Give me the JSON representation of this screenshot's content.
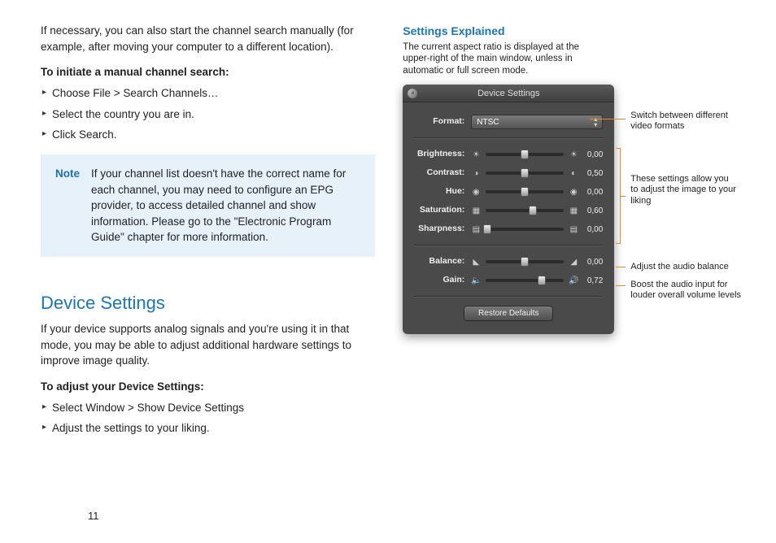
{
  "page_number": "11",
  "left": {
    "intro": "If necessary, you can also start the channel search manually (for example, after moving your computer to a different location).",
    "manual_search_heading": "To initiate a manual channel search:",
    "manual_search_steps": [
      "Choose File > Search Channels…",
      "Select the country you are in.",
      "Click Search."
    ],
    "note_label": "Note",
    "note_body": "If your channel list doesn't have the correct name for each channel, you may need to configure an EPG provider, to access detailed channel and show information. Please go to the \"Electronic Program Guide\" chapter for more information.",
    "h2": "Device Settings",
    "ds_intro": "If your device supports analog signals and you're using it in that mode, you may be able to adjust additional hardware settings to improve image quality.",
    "ds_heading": "To adjust your Device Settings:",
    "ds_steps": [
      "Select Window > Show Device Settings",
      "Adjust the settings to your liking."
    ]
  },
  "right": {
    "se_title": "Settings Explained",
    "se_caption": "The current aspect ratio is displayed at the upper-right of the main window, unless in automatic or full screen mode.",
    "panel_title": "Device Settings",
    "format_label": "Format:",
    "format_value": "NTSC",
    "sliders": [
      {
        "name": "Brightness:",
        "value": "0,00",
        "pos": 0.5,
        "icon_left": "☀",
        "icon_right": "☀"
      },
      {
        "name": "Contrast:",
        "value": "0,50",
        "pos": 0.5,
        "icon_left": "◑",
        "icon_right": "◐"
      },
      {
        "name": "Hue:",
        "value": "0,00",
        "pos": 0.5,
        "icon_left": "◉",
        "icon_right": "◉"
      },
      {
        "name": "Saturation:",
        "value": "0,60",
        "pos": 0.6,
        "icon_left": "▦",
        "icon_right": "▦"
      },
      {
        "name": "Sharpness:",
        "value": "0,00",
        "pos": 0.02,
        "icon_left": "▤",
        "icon_right": "▤"
      }
    ],
    "audio_sliders": [
      {
        "name": "Balance:",
        "value": "0,00",
        "pos": 0.5,
        "icon_left": "◣",
        "icon_right": "◢"
      },
      {
        "name": "Gain:",
        "value": "0,72",
        "pos": 0.72,
        "icon_left": "🔈",
        "icon_right": "🔊"
      }
    ],
    "restore_label": "Restore Defaults",
    "callouts": {
      "format": "Switch between different video formats",
      "image": "These settings allow you to adjust the image to your liking",
      "balance": "Adjust the audio balance",
      "gain": "Boost the audio input for louder overall volume levels"
    }
  }
}
